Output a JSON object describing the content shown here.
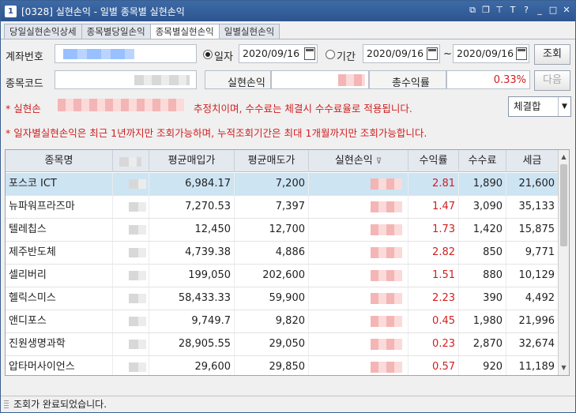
{
  "window": {
    "number": "1",
    "title": "[0328] 실현손익 - 일별 종목별 실현손익"
  },
  "tabs": [
    {
      "label": "당일실현손익상세"
    },
    {
      "label": "종목별당일손익"
    },
    {
      "label": "종목별실현손익"
    },
    {
      "label": "일별실현손익"
    }
  ],
  "form": {
    "account_label": "계좌번호",
    "code_label": "종목코드",
    "radio_day_label": "일자",
    "radio_period_label": "기간",
    "date_single": "2020/09/16",
    "date_from": "2020/09/16",
    "date_to": "2020/09/16",
    "tilde": "~",
    "query_button": "조회",
    "next_button": "다음",
    "realized_label": "실현손익",
    "total_return_label": "총수익률",
    "total_return_value": "0.33%"
  },
  "notes": {
    "line1_prefix": "* 실현손",
    "line1_suffix": "추정치이며, 수수료는 체결시 수수료율로 적용됩니다.",
    "line2": "* 일자별실현손익은 최근 1년까지만 조회가능하며, 누적조회기간은 최대 1개월까지만 조회가능합니다."
  },
  "select": {
    "value": "체결합"
  },
  "table": {
    "headers": [
      "종목명",
      "",
      "평균매입가",
      "평균매도가",
      "실현손익",
      "수익률",
      "수수료",
      "세금"
    ],
    "sort_icon": "filter-icon",
    "rows": [
      {
        "name": "포스코 ICT",
        "avg_buy": "6,984.17",
        "avg_sell": "7,200",
        "rate": "2.81",
        "fee": "1,890",
        "tax": "21,600"
      },
      {
        "name": "뉴파워프라즈마",
        "avg_buy": "7,270.53",
        "avg_sell": "7,397",
        "rate": "1.47",
        "fee": "3,090",
        "tax": "35,133"
      },
      {
        "name": "텔레칩스",
        "avg_buy": "12,450",
        "avg_sell": "12,700",
        "rate": "1.73",
        "fee": "1,420",
        "tax": "15,875"
      },
      {
        "name": "제주반도체",
        "avg_buy": "4,739.38",
        "avg_sell": "4,886",
        "rate": "2.82",
        "fee": "850",
        "tax": "9,771"
      },
      {
        "name": "셀리버리",
        "avg_buy": "199,050",
        "avg_sell": "202,600",
        "rate": "1.51",
        "fee": "880",
        "tax": "10,129"
      },
      {
        "name": "헬릭스미스",
        "avg_buy": "58,433.33",
        "avg_sell": "59,900",
        "rate": "2.23",
        "fee": "390",
        "tax": "4,492"
      },
      {
        "name": "앤디포스",
        "avg_buy": "9,749.7",
        "avg_sell": "9,820",
        "rate": "0.45",
        "fee": "1,980",
        "tax": "21,996"
      },
      {
        "name": "진원생명과학",
        "avg_buy": "28,905.55",
        "avg_sell": "29,050",
        "rate": "0.23",
        "fee": "2,870",
        "tax": "32,674"
      },
      {
        "name": "압타머사이언스",
        "avg_buy": "29,600",
        "avg_sell": "29,850",
        "rate": "0.57",
        "fee": "920",
        "tax": "11,189"
      }
    ]
  },
  "status": {
    "message": "조회가 완료되었습니다."
  },
  "colors": {
    "title_bar": "#2d5590",
    "selected_row": "#cde4f3",
    "red_text": "#d11e1e"
  }
}
